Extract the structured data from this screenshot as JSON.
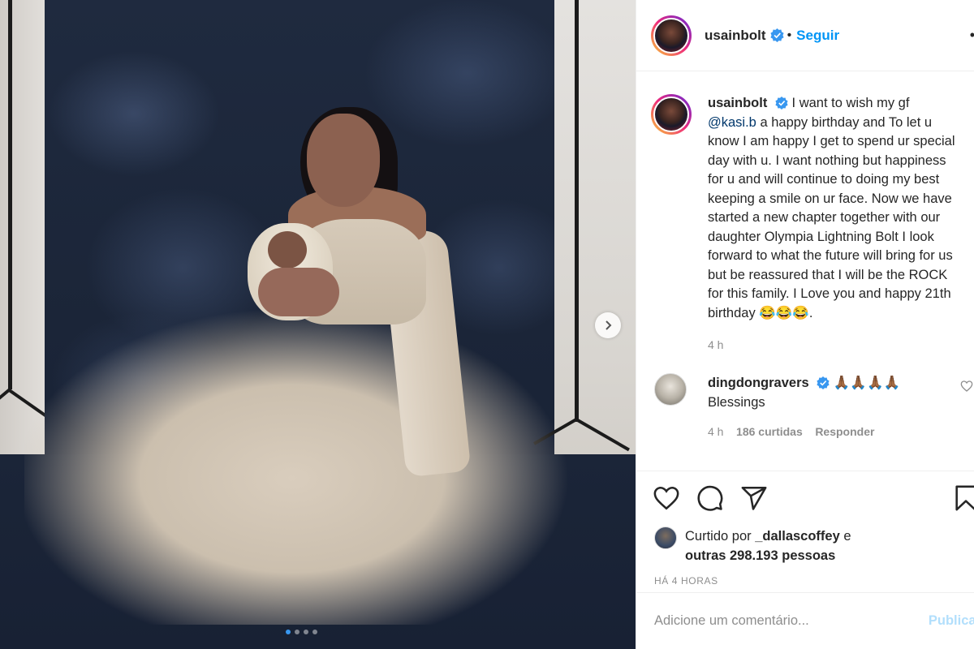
{
  "post": {
    "author": "usainbolt",
    "follow_label": "Seguir",
    "separator": "•",
    "more_label": "•"
  },
  "caption": {
    "author": "usainbolt",
    "prefix": "I want to wish my gf",
    "mention": "@kasi.b",
    "body": "a happy birthday and To let u know I am happy I get to spend ur special day with u. I want nothing but happiness for u and will continue to doing my best keeping a smile on ur face. Now we have started a new chapter together with our daughter Olympia Lightning Bolt I look forward to what the future will bring for us but be reassured that I will be the ROCK for this family. I Love you and happy 21th birthday 😂😂😂.",
    "time": "4 h"
  },
  "comments": [
    {
      "author": "dingdongravers",
      "emoji": "🙏🏾🙏🏾🙏🏾🙏🏾",
      "text": "Blessings",
      "time": "4 h",
      "likes": "186 curtidas",
      "reply": "Responder"
    }
  ],
  "likes": {
    "prefix": "Curtido por",
    "user": "_dallascoffey",
    "connector": "e",
    "others": "outras 298.193 pessoas"
  },
  "posted_ago": "HÁ 4 HORAS",
  "comment_box": {
    "placeholder": "Adicione um comentário...",
    "publish": "Publicar"
  },
  "carousel": {
    "slide_count": 4,
    "active_index": 0
  },
  "colors": {
    "link": "#0095f6",
    "verified": "#3897f0",
    "mention": "#00376b",
    "muted": "#8e8e8e"
  },
  "icons": [
    "like-icon",
    "comment-icon",
    "share-icon",
    "bookmark-icon",
    "chevron-right-icon",
    "verified-icon",
    "heart-icon"
  ]
}
